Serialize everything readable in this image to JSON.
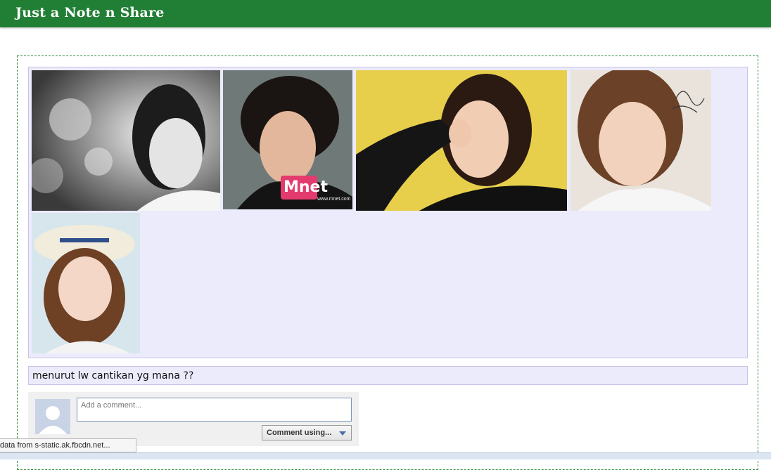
{
  "header": {
    "title": "Just a Note n Share"
  },
  "gallery": {
    "photos": [
      {
        "name": "photo-1",
        "theme": "grayscale"
      },
      {
        "name": "photo-2",
        "theme": "mnet"
      },
      {
        "name": "photo-3",
        "theme": "yellow"
      },
      {
        "name": "photo-4",
        "theme": "signature"
      },
      {
        "name": "photo-5",
        "theme": "hat"
      }
    ],
    "watermark": "Mnet",
    "watermark_url": "www.mnet.com"
  },
  "post": {
    "caption": "menurut lw cantikan yg mana ??"
  },
  "comment": {
    "placeholder": "Add a comment...",
    "button_label": "Comment using..."
  },
  "status": {
    "text": "data from s-static.ak.fbcdn.net..."
  },
  "colors": {
    "header_bg": "#217e35",
    "panel_bg": "#ecebfb",
    "border_dashed": "#2f8a3e"
  }
}
